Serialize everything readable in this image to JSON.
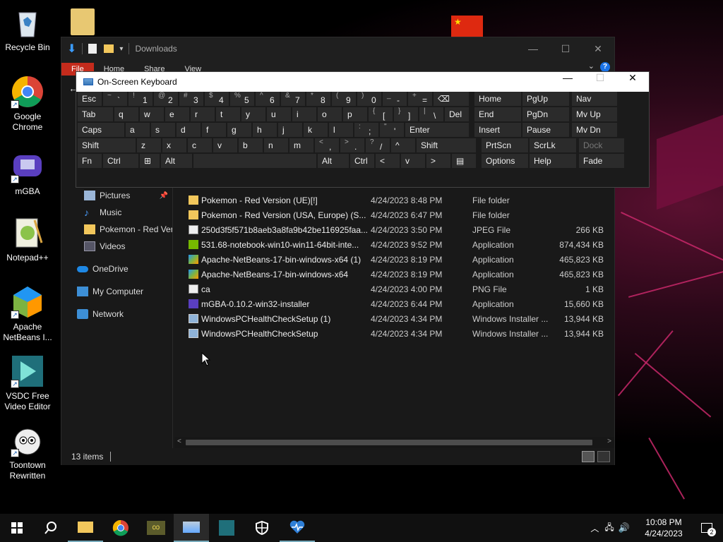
{
  "desktop": {
    "icons": [
      {
        "label": "Recycle Bin",
        "icon": "recycle-bin-icon"
      },
      {
        "label": "Google Chrome",
        "icon": "chrome-icon"
      },
      {
        "label": "mGBA",
        "icon": "mgba-icon"
      },
      {
        "label": "Notepad++",
        "icon": "notepadpp-icon"
      },
      {
        "label": "Apache NetBeans I...",
        "icon": "netbeans-icon"
      },
      {
        "label": "VSDC Free Video Editor",
        "icon": "vsdc-icon"
      },
      {
        "label": "Toontown Rewritten",
        "icon": "toontown-icon"
      }
    ]
  },
  "explorer": {
    "title": "Downloads",
    "ribbon_tabs": [
      "File",
      "Home",
      "Share",
      "View"
    ],
    "nav_items": [
      {
        "label": "Pictures",
        "icon": "pictures-folder-icon",
        "pinned": true
      },
      {
        "label": "Music",
        "icon": "music-folder-icon",
        "pinned": false
      },
      {
        "label": "Pokemon - Red Vers",
        "icon": "folder-icon",
        "pinned": false
      },
      {
        "label": "Videos",
        "icon": "videos-folder-icon",
        "pinned": false
      },
      {
        "label": "OneDrive",
        "icon": "onedrive-icon",
        "pinned": false
      },
      {
        "label": "My Computer",
        "icon": "computer-icon",
        "pinned": false
      },
      {
        "label": "Network",
        "icon": "network-icon",
        "pinned": false
      }
    ],
    "files": [
      {
        "name": "Pokemon - Red Version (UE)[!]",
        "date": "4/24/2023 8:48 PM",
        "type": "File folder",
        "size": "",
        "icon": "folder-icon"
      },
      {
        "name": "Pokemon - Red Version (USA, Europe) (S...",
        "date": "4/24/2023 6:47 PM",
        "type": "File folder",
        "size": "",
        "icon": "folder-icon"
      },
      {
        "name": "250d3f5f571b8aeb3a8fa9b42be116925faa...",
        "date": "4/24/2023 3:50 PM",
        "type": "JPEG File",
        "size": "266 KB",
        "icon": "image-file-icon"
      },
      {
        "name": "531.68-notebook-win10-win11-64bit-inte...",
        "date": "4/24/2023 9:52 PM",
        "type": "Application",
        "size": "874,434 KB",
        "icon": "nvidia-app-icon"
      },
      {
        "name": "Apache-NetBeans-17-bin-windows-x64 (1)",
        "date": "4/24/2023 8:19 PM",
        "type": "Application",
        "size": "465,823 KB",
        "icon": "netbeans-app-icon"
      },
      {
        "name": "Apache-NetBeans-17-bin-windows-x64",
        "date": "4/24/2023 8:19 PM",
        "type": "Application",
        "size": "465,823 KB",
        "icon": "netbeans-app-icon"
      },
      {
        "name": "ca",
        "date": "4/24/2023 4:00 PM",
        "type": "PNG File",
        "size": "1 KB",
        "icon": "image-file-icon"
      },
      {
        "name": "mGBA-0.10.2-win32-installer",
        "date": "4/24/2023 6:44 PM",
        "type": "Application",
        "size": "15,660 KB",
        "icon": "installer-icon"
      },
      {
        "name": "WindowsPCHealthCheckSetup (1)",
        "date": "4/24/2023 4:34 PM",
        "type": "Windows Installer ...",
        "size": "13,944 KB",
        "icon": "msi-icon"
      },
      {
        "name": "WindowsPCHealthCheckSetup",
        "date": "4/24/2023 4:34 PM",
        "type": "Windows Installer ...",
        "size": "13,944 KB",
        "icon": "msi-icon"
      }
    ],
    "status": {
      "item_count": "13 items"
    }
  },
  "osk": {
    "title": "On-Screen Keyboard",
    "rows": [
      [
        {
          "m": "Esc"
        },
        {
          "s": "~",
          "m": "`"
        },
        {
          "s": "!",
          "m": "1"
        },
        {
          "s": "@",
          "m": "2"
        },
        {
          "s": "#",
          "m": "3"
        },
        {
          "s": "$",
          "m": "4"
        },
        {
          "s": "%",
          "m": "5"
        },
        {
          "s": "^",
          "m": "6"
        },
        {
          "s": "&",
          "m": "7"
        },
        {
          "s": "*",
          "m": "8"
        },
        {
          "s": "(",
          "m": "9"
        },
        {
          "s": ")",
          "m": "0"
        },
        {
          "s": "_",
          "m": "-"
        },
        {
          "s": "+",
          "m": "="
        },
        {
          "m": "⌫"
        },
        {
          "m": "Home"
        },
        {
          "m": "PgUp"
        },
        {
          "m": "Nav"
        }
      ],
      [
        {
          "m": "Tab"
        },
        {
          "m": "q"
        },
        {
          "m": "w"
        },
        {
          "m": "e"
        },
        {
          "m": "r"
        },
        {
          "m": "t"
        },
        {
          "m": "y"
        },
        {
          "m": "u"
        },
        {
          "m": "i"
        },
        {
          "m": "o"
        },
        {
          "m": "p"
        },
        {
          "s": "{",
          "m": "["
        },
        {
          "s": "}",
          "m": "]"
        },
        {
          "s": "|",
          "m": "\\"
        },
        {
          "m": "Del"
        },
        {
          "m": "End"
        },
        {
          "m": "PgDn"
        },
        {
          "m": "Mv Up"
        }
      ],
      [
        {
          "m": "Caps"
        },
        {
          "m": "a"
        },
        {
          "m": "s"
        },
        {
          "m": "d"
        },
        {
          "m": "f"
        },
        {
          "m": "g"
        },
        {
          "m": "h"
        },
        {
          "m": "j"
        },
        {
          "m": "k"
        },
        {
          "m": "l"
        },
        {
          "s": ":",
          "m": ";"
        },
        {
          "s": "\"",
          "m": "'"
        },
        {
          "m": "Enter"
        },
        {
          "m": "Insert"
        },
        {
          "m": "Pause"
        },
        {
          "m": "Mv Dn"
        }
      ],
      [
        {
          "m": "Shift"
        },
        {
          "m": "z"
        },
        {
          "m": "x"
        },
        {
          "m": "c"
        },
        {
          "m": "v"
        },
        {
          "m": "b"
        },
        {
          "m": "n"
        },
        {
          "m": "m"
        },
        {
          "s": "<",
          "m": ","
        },
        {
          "s": ">",
          "m": "."
        },
        {
          "s": "?",
          "m": "/"
        },
        {
          "m": "^"
        },
        {
          "m": "Shift"
        },
        {
          "m": "PrtScn"
        },
        {
          "m": "ScrLk"
        },
        {
          "m": "Dock"
        }
      ],
      [
        {
          "m": "Fn"
        },
        {
          "m": "Ctrl"
        },
        {
          "m": "⊞"
        },
        {
          "m": "Alt"
        },
        {
          "m": ""
        },
        {
          "m": "Alt"
        },
        {
          "m": "Ctrl"
        },
        {
          "m": "<"
        },
        {
          "m": "v"
        },
        {
          "m": ">"
        },
        {
          "m": "▤"
        },
        {
          "m": "Options"
        },
        {
          "m": "Help"
        },
        {
          "m": "Fade"
        }
      ]
    ]
  },
  "taskbar": {
    "time": "10:08 PM",
    "date": "4/24/2023",
    "notifications": "2",
    "apps": [
      "start-icon",
      "search-icon",
      "file-explorer-icon",
      "chrome-icon",
      "infinity-app-icon",
      "osk-icon",
      "vsdc-icon",
      "security-icon",
      "health-icon"
    ]
  }
}
